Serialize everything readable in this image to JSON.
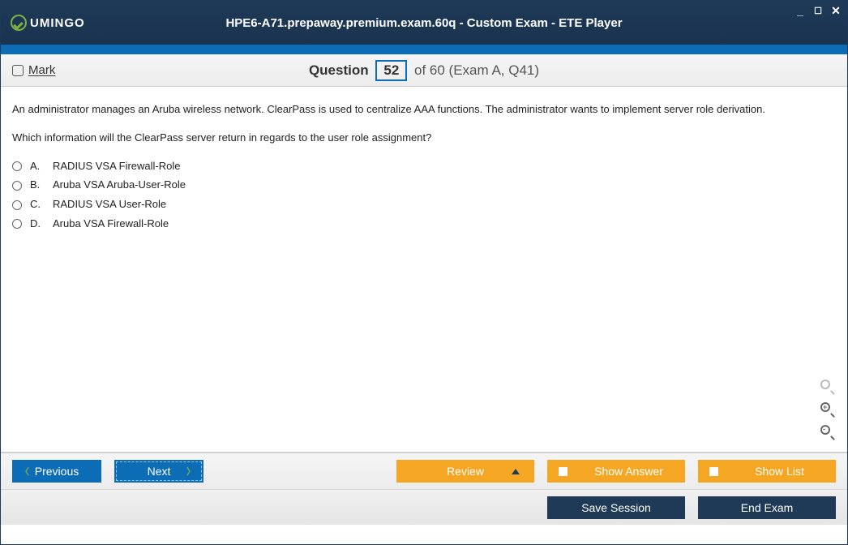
{
  "app": {
    "brand": "UMINGO",
    "title": "HPE6-A71.prepaway.premium.exam.60q - Custom Exam - ETE Player"
  },
  "infobar": {
    "mark_label": "Mark",
    "question_word": "Question",
    "current_num": "52",
    "total_text": " of 60 (Exam A, Q41)"
  },
  "question": {
    "para1": "An administrator manages an Aruba wireless network. ClearPass is used to centralize AAA functions. The administrator wants to implement server role derivation.",
    "para2": "Which information will the ClearPass server return in regards to the user role assignment?"
  },
  "options": [
    {
      "letter": "A.",
      "text": "RADIUS VSA Firewall-Role"
    },
    {
      "letter": "B.",
      "text": "Aruba VSA Aruba-User-Role"
    },
    {
      "letter": "C.",
      "text": "RADIUS VSA User-Role"
    },
    {
      "letter": "D.",
      "text": "Aruba VSA Firewall-Role"
    }
  ],
  "footer": {
    "previous": "Previous",
    "next": "Next",
    "review": "Review",
    "show_answer": "Show Answer",
    "show_list": "Show List",
    "save_session": "Save Session",
    "end_exam": "End Exam"
  }
}
